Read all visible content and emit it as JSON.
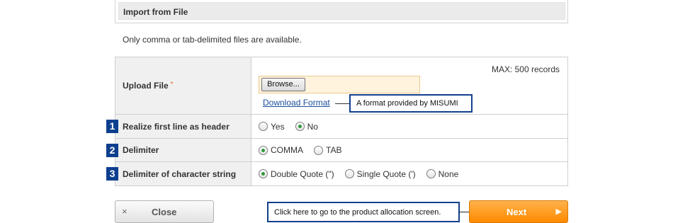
{
  "section": {
    "title": "Import from File"
  },
  "notice": "Only comma or tab-delimited files are available.",
  "upload": {
    "label": "Upload File",
    "required_mark": "*",
    "max_records": "MAX: 500 records",
    "browse_label": "Browse...",
    "download_link": "Download Format",
    "callout": "A format provided by MISUMI"
  },
  "rows": [
    {
      "number": "1",
      "label": "Realize first line as header",
      "options": [
        {
          "label": "Yes",
          "selected": false
        },
        {
          "label": "No",
          "selected": true
        }
      ]
    },
    {
      "number": "2",
      "label": "Delimiter",
      "options": [
        {
          "label": "COMMA",
          "selected": true
        },
        {
          "label": "TAB",
          "selected": false
        }
      ]
    },
    {
      "number": "3",
      "label": "Delimiter of character string",
      "options": [
        {
          "label": "Double Quote (\")",
          "selected": true
        },
        {
          "label": "Single Quote (')",
          "selected": false
        },
        {
          "label": "None",
          "selected": false
        }
      ]
    }
  ],
  "buttons": {
    "close_icon": "×",
    "close_label": "Close",
    "next_label": "Next",
    "next_arrow": "▶",
    "next_callout": "Click here to go to the product allocation screen."
  },
  "colors": {
    "number_badge": "#0d3f8f",
    "callout_border": "#123f8c",
    "next_button": "#ff9a1a",
    "radio_selected": "#2f9a3c",
    "required": "#e36a2a"
  }
}
